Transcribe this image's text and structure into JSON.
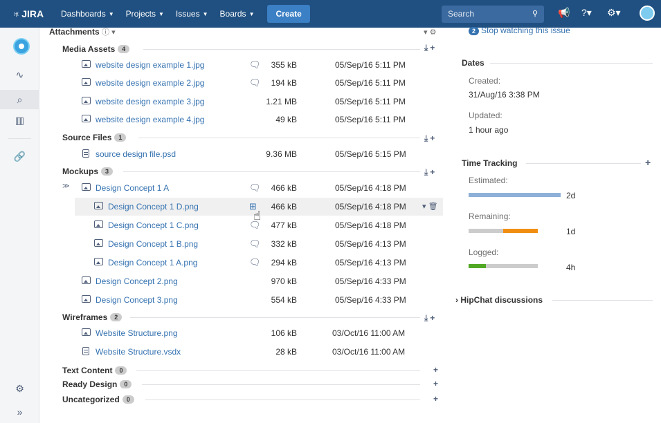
{
  "nav": {
    "logo": "JIRA",
    "items": [
      "Dashboards",
      "Projects",
      "Issues",
      "Boards"
    ],
    "create": "Create",
    "search_placeholder": "Search"
  },
  "attachments": {
    "title": "Attachments",
    "groups": [
      {
        "label": "Media Assets",
        "count": "4"
      },
      {
        "label": "Source Files",
        "count": "1"
      },
      {
        "label": "Mockups",
        "count": "3"
      },
      {
        "label": "Wireframes",
        "count": "2"
      },
      {
        "label": "Text Content",
        "count": "0"
      },
      {
        "label": "Ready Design",
        "count": "0"
      },
      {
        "label": "Uncategorized",
        "count": "0"
      }
    ],
    "files": [
      {
        "name": "website design example 1.jpg",
        "size": "355 kB",
        "date": "05/Sep/16 5:11 PM"
      },
      {
        "name": "website design example 2.jpg",
        "size": "194 kB",
        "date": "05/Sep/16 5:11 PM"
      },
      {
        "name": "website design example 3.jpg",
        "size": "1.21 MB",
        "date": "05/Sep/16 5:11 PM"
      },
      {
        "name": "website design example 4.jpg",
        "size": "49 kB",
        "date": "05/Sep/16 5:11 PM"
      },
      {
        "name": "source design file.psd",
        "size": "9.36 MB",
        "date": "05/Sep/16 5:15 PM"
      },
      {
        "name": "Design Concept 1 A",
        "size": "466 kB",
        "date": "05/Sep/16 4:18 PM"
      },
      {
        "name": "Design Concept 1 D.png",
        "size": "466 kB",
        "date": "05/Sep/16 4:18 PM"
      },
      {
        "name": "Design Concept 1 C.png",
        "size": "477 kB",
        "date": "05/Sep/16 4:18 PM"
      },
      {
        "name": "Design Concept 1 B.png",
        "size": "332 kB",
        "date": "05/Sep/16 4:13 PM"
      },
      {
        "name": "Design Concept 1 A.png",
        "size": "294 kB",
        "date": "05/Sep/16 4:13 PM"
      },
      {
        "name": "Design Concept 2.png",
        "size": "970 kB",
        "date": "05/Sep/16 4:33 PM"
      },
      {
        "name": "Design Concept 3.png",
        "size": "554 kB",
        "date": "05/Sep/16 4:33 PM"
      },
      {
        "name": "Website Structure.png",
        "size": "106 kB",
        "date": "03/Oct/16 11:00 AM"
      },
      {
        "name": "Website Structure.vsdx",
        "size": "28 kB",
        "date": "03/Oct/16 11:00 AM"
      }
    ]
  },
  "right": {
    "watch_count": "2",
    "watch_label": "Stop watching this issue",
    "dates_title": "Dates",
    "created_label": "Created:",
    "created_value": "31/Aug/16 3:38 PM",
    "updated_label": "Updated:",
    "updated_value": "1 hour ago",
    "time_title": "Time Tracking",
    "estimated_label": "Estimated:",
    "estimated_value": "2d",
    "estimated_fill": 1.0,
    "remaining_label": "Remaining:",
    "remaining_value": "1d",
    "remaining_fill": 0.5,
    "logged_label": "Logged:",
    "logged_value": "4h",
    "logged_fill": 0.25,
    "hipchat_title": "HipChat discussions",
    "colors": {
      "estimated": "#8eb0d8",
      "remaining": "#f18e12",
      "logged": "#51a825",
      "track": "#cccccc"
    }
  }
}
